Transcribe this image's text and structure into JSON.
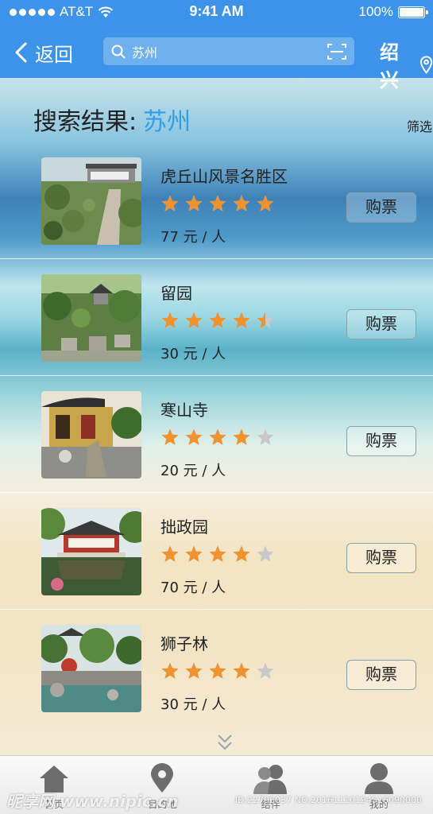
{
  "status_bar": {
    "carrier": "AT&T",
    "time": "9:41 AM",
    "battery": "100%"
  },
  "nav": {
    "back_label": "返回",
    "search_value": "苏州",
    "city": "绍兴"
  },
  "results": {
    "title": "搜索结果:",
    "keyword": "苏州",
    "filter_label": "筛选"
  },
  "items": [
    {
      "name": "虎丘山风景名胜区",
      "rating": 5,
      "price": "77 元 / 人",
      "buy_label": "购票"
    },
    {
      "name": "留园",
      "rating": 4.5,
      "price": "30 元 / 人",
      "buy_label": "购票"
    },
    {
      "name": "寒山寺",
      "rating": 4,
      "price": "20 元 / 人",
      "buy_label": "购票"
    },
    {
      "name": "拙政园",
      "rating": 4,
      "price": "70 元 / 人",
      "buy_label": "购票"
    },
    {
      "name": "狮子林",
      "rating": 4,
      "price": "30 元 / 人",
      "buy_label": "购票"
    }
  ],
  "tabbar": {
    "tabs": [
      {
        "label": "首页",
        "icon": "home-icon"
      },
      {
        "label": "目的地",
        "icon": "location-icon"
      },
      {
        "label": "结伴",
        "icon": "group-icon"
      },
      {
        "label": "我的",
        "icon": "user-icon"
      }
    ]
  },
  "watermark": {
    "site": "昵享网 www.nipic.cn",
    "id": "ID:22796037 NO:20161110194516090000"
  },
  "colors": {
    "nav_blue": "#3d93ea",
    "keyword_blue": "#2f9ee8",
    "star_orange": "#f0922e",
    "star_empty": "#c8c8c8"
  }
}
